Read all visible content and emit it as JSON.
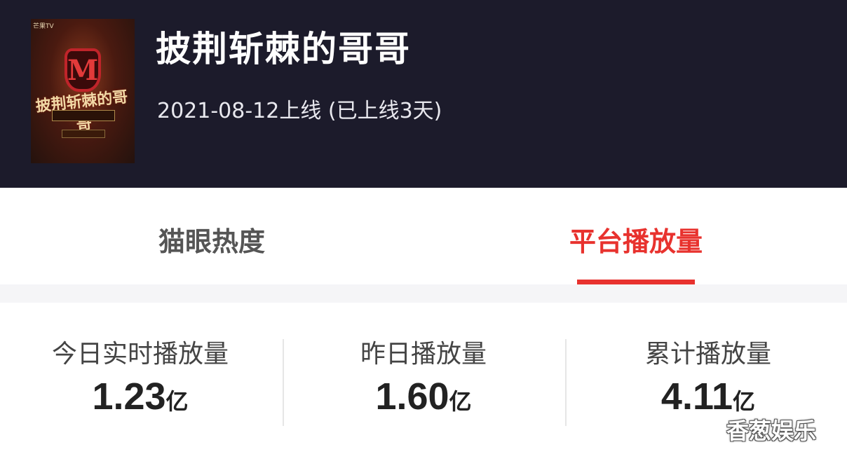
{
  "header": {
    "title": "披荆斩棘的哥哥",
    "release_info": "2021-08-12上线 (已上线3天)",
    "background_color": "#1c1b2b"
  },
  "poster": {
    "title_text": "披荆斩棘的哥哥",
    "emblem_letter": "M"
  },
  "tabs": [
    {
      "label": "猫眼热度",
      "active": false
    },
    {
      "label": "平台播放量",
      "active": true
    }
  ],
  "accent_color": "#e8322e",
  "stats": [
    {
      "label": "今日实时播放量",
      "value": "1.23",
      "unit": "亿"
    },
    {
      "label": "昨日播放量",
      "value": "1.60",
      "unit": "亿"
    },
    {
      "label": "累计播放量",
      "value": "4.11",
      "unit": "亿"
    }
  ],
  "watermark": "香葱娱乐"
}
